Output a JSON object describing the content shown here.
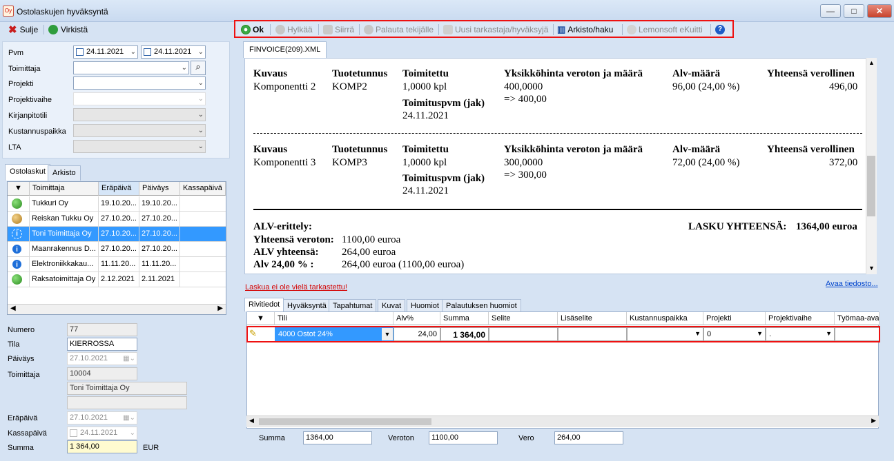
{
  "window": {
    "title": "Ostolaskujen hyväksyntä",
    "icon_label": "Oy",
    "minimize": "—",
    "maximize": "□",
    "close": "✕"
  },
  "left_toolbar": {
    "close_label": "Sulje",
    "refresh_label": "Virkistä"
  },
  "filters": {
    "pvm_label": "Pvm",
    "date_from": "24.11.2021",
    "date_to": "24.11.2021",
    "toimittaja_label": "Toimittaja",
    "projekti_label": "Projekti",
    "projektivaihe_label": "Projektivaihe",
    "kirjanpitotili_label": "Kirjanpitotili",
    "kustannuspaikka_label": "Kustannuspaikka",
    "lta_label": "LTA"
  },
  "left_tabs": {
    "purchases": "Ostolaskut",
    "archive": "Arkisto"
  },
  "invoice_table": {
    "headers": [
      "Toimittaja",
      "Eräpäivä",
      "Päiväys",
      "Kassapäivä"
    ],
    "rows": [
      {
        "status": "green",
        "supplier": "Tukkuri Oy",
        "due": "19.10.20...",
        "date": "19.10.20..."
      },
      {
        "status": "orange",
        "supplier": "Reiskan Tukku Oy",
        "due": "27.10.20...",
        "date": "27.10.20..."
      },
      {
        "status": "info-selected",
        "supplier": "Toni Toimittaja Oy",
        "due": "27.10.20...",
        "date": "27.10.20..."
      },
      {
        "status": "info",
        "supplier": "Maanrakennus D...",
        "due": "27.10.20...",
        "date": "27.10.20..."
      },
      {
        "status": "info",
        "supplier": "Elektroniikkakau...",
        "due": "11.11.20...",
        "date": "11.11.20..."
      },
      {
        "status": "green",
        "supplier": "Raksatoimittaja Oy",
        "due": "2.12.2021",
        "date": "2.11.2021"
      }
    ]
  },
  "details": {
    "numero_label": "Numero",
    "numero": "77",
    "tila_label": "Tila",
    "tila": "KIERROSSA",
    "paivays_label": "Päiväys",
    "paivays": "27.10.2021",
    "toimittaja_label": "Toimittaja",
    "toimittaja_id": "10004",
    "toimittaja_name": "Toni Toimittaja Oy",
    "erapaiva_label": "Eräpäivä",
    "erapaiva": "27.10.2021",
    "kassapaiva_label": "Kassapäivä",
    "kassapaiva": "24.11.2021",
    "summa_label": "Summa",
    "summa": "1 364,00",
    "currency": "EUR"
  },
  "right_toolbar": {
    "ok": "Ok",
    "reject": "Hylkää",
    "move": "Siirrä",
    "return": "Palauta tekijälle",
    "new_reviewer": "Uusi tarkastaja/hyväksyjä",
    "archive": "Arkisto/haku",
    "ekuitti": "Lemonsoft eKuitti",
    "help": "?"
  },
  "document": {
    "tab": "FINVOICE(209).XML",
    "col_headers": [
      "Kuvaus",
      "Tuotetunnus",
      "Toimitettu",
      "Yksikköhinta veroton ja määrä",
      "Alv-määrä",
      "Yhteensä verollinen"
    ],
    "delivery_date_label": "Toimituspvm (jak)",
    "items": [
      {
        "desc": "Komponentti 2",
        "code": "KOMP2",
        "qty": "1,0000 kpl",
        "unit": "400,0000",
        "unit_total": "=> 400,00",
        "vat": "96,00 (24,00 %)",
        "total": "496,00",
        "delivery_date": "24.11.2021"
      },
      {
        "desc": "Komponentti 3",
        "code": "KOMP3",
        "qty": "1,0000 kpl",
        "unit": "300,0000",
        "unit_total": "=> 300,00",
        "vat": "72,00 (24,00 %)",
        "total": "372,00",
        "delivery_date": "24.11.2021"
      }
    ],
    "vat_breakdown_label": "ALV-erittely:",
    "invoice_total_label": "LASKU YHTEENSÄ:",
    "invoice_total": "1364,00 euroa",
    "net_label": "Yhteensä veroton:",
    "net": "1100,00 euroa",
    "vat_total_label": "ALV yhteensä:",
    "vat_total": "264,00 euroa",
    "vat24_label": "Alv 24,00 % :",
    "vat24": "264,00 euroa (1100,00 euroa)"
  },
  "status_text": "Laskua ei ole vielä tarkastettu!",
  "open_file": "Avaa tiedosto...",
  "lower_tabs": [
    "Rivitiedot",
    "Hyväksyntä",
    "Tapahtumat",
    "Kuvat",
    "Huomiot",
    "Palautuksen huomiot"
  ],
  "grid": {
    "headers": [
      "Tili",
      "Alv%",
      "Summa",
      "Selite",
      "Lisäselite",
      "Kustannuspaikka",
      "Projekti",
      "Projektivaihe",
      "Työmaa-ava"
    ],
    "row": {
      "account": "4000 Ostot 24%",
      "vat": "24,00",
      "sum": "1 364,00",
      "project": "0",
      "phase": "."
    }
  },
  "totals": {
    "summa_label": "Summa",
    "summa": "1364,00",
    "veroton_label": "Veroton",
    "veroton": "1100,00",
    "vero_label": "Vero",
    "vero": "264,00"
  }
}
